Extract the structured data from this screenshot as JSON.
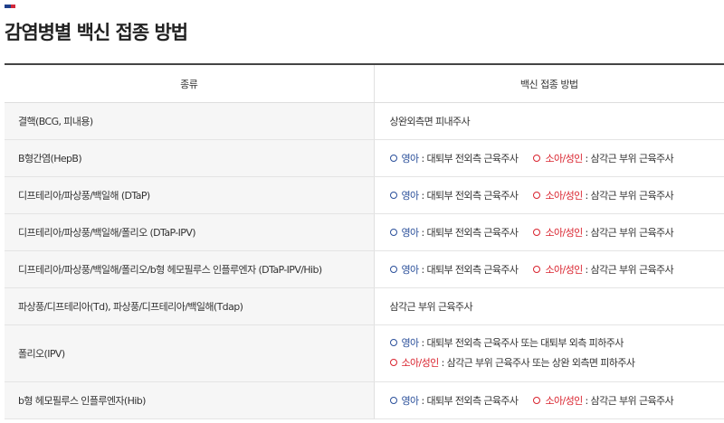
{
  "page": {
    "title": "감염병별 백신 접종 방법",
    "accent_colors": [
      "#1f3f8a",
      "#d2283a"
    ]
  },
  "table": {
    "headers": [
      "종류",
      "백신 접종 방법"
    ],
    "rows": [
      {
        "name": "결핵(BCG, 피내용)",
        "plain": "상완외측면 피내주사"
      },
      {
        "name": "B형간염(HepB)",
        "infant_label": "영아",
        "infant_text": "대퇴부 전외측 근육주사",
        "child_label": "소아/성인",
        "child_text": "삼각근 부위 근육주사"
      },
      {
        "name": "디프테리아/파상풍/백일해 (DTaP)",
        "infant_label": "영아",
        "infant_text": "대퇴부 전외측 근육주사",
        "child_label": "소아/성인",
        "child_text": "삼각근 부위 근육주사"
      },
      {
        "name": "디프테리아/파상풍/백일해/폴리오 (DTaP-IPV)",
        "infant_label": "영아",
        "infant_text": "대퇴부 전외측 근육주사",
        "child_label": "소아/성인",
        "child_text": "삼각근 부위 근육주사"
      },
      {
        "name": "디프테리아/파상풍/백일해/폴리오/b형 헤모필루스 인플루엔자 (DTaP-IPV/Hib)",
        "infant_label": "영아",
        "infant_text": "대퇴부 전외측 근육주사",
        "child_label": "소아/성인",
        "child_text": "삼각근 부위 근육주사"
      },
      {
        "name": "파상풍/디프테리아(Td), 파상풍/디프테리아/백일해(Tdap)",
        "plain": "삼각근 부위 근육주사"
      },
      {
        "name": "폴리오(IPV)",
        "infant_label": "영아",
        "infant_text": "대퇴부 전외측 근육주사 또는 대퇴부 외측 피하주사",
        "child_label": "소아/성인",
        "child_text": "삼각근 부위 근육주사 또는 상완 외측면 피하주사"
      },
      {
        "name": "b형 헤모필루스 인플루엔자(Hib)",
        "infant_label": "영아",
        "infant_text": "대퇴부 전외측 근육주사",
        "child_label": "소아/성인",
        "child_text": "삼각근 부위 근육주사"
      }
    ]
  }
}
